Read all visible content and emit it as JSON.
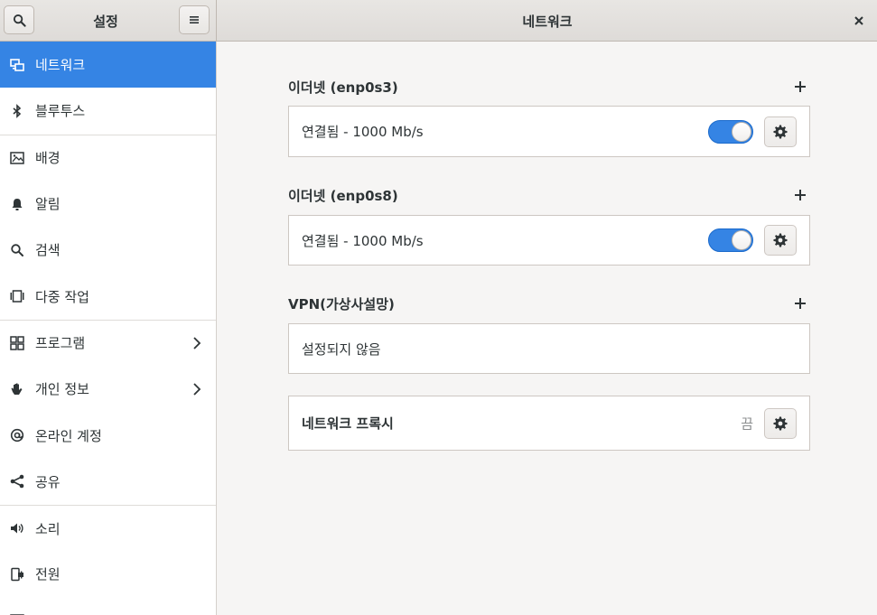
{
  "header": {
    "sidebar_title": "설정",
    "main_title": "네트워크"
  },
  "sidebar": {
    "items": [
      {
        "label": "네트워크",
        "icon": "network-icon"
      },
      {
        "label": "블루투스",
        "icon": "bluetooth-icon"
      },
      {
        "label": "배경",
        "icon": "background-icon"
      },
      {
        "label": "알림",
        "icon": "bell-icon"
      },
      {
        "label": "검색",
        "icon": "search-icon"
      },
      {
        "label": "다중 작업",
        "icon": "multitasking-icon"
      },
      {
        "label": "프로그램",
        "icon": "apps-grid-icon"
      },
      {
        "label": "개인 정보",
        "icon": "hand-icon"
      },
      {
        "label": "온라인 계정",
        "icon": "at-icon"
      },
      {
        "label": "공유",
        "icon": "share-icon"
      },
      {
        "label": "소리",
        "icon": "speaker-icon"
      },
      {
        "label": "전원",
        "icon": "power-plug-icon"
      }
    ]
  },
  "network": {
    "ethernet1": {
      "title": "이더넷 (enp0s3)",
      "status": "연결됨 - 1000 Mb/s",
      "enabled": true
    },
    "ethernet2": {
      "title": "이더넷 (enp0s8)",
      "status": "연결됨 - 1000 Mb/s",
      "enabled": true
    },
    "vpn": {
      "title": "VPN(가상사설망)",
      "status": "설정되지 않음"
    },
    "proxy": {
      "label": "네트워크 프록시",
      "status": "끔"
    }
  },
  "colors": {
    "accent": "#3584e4",
    "background": "#f6f5f4"
  }
}
